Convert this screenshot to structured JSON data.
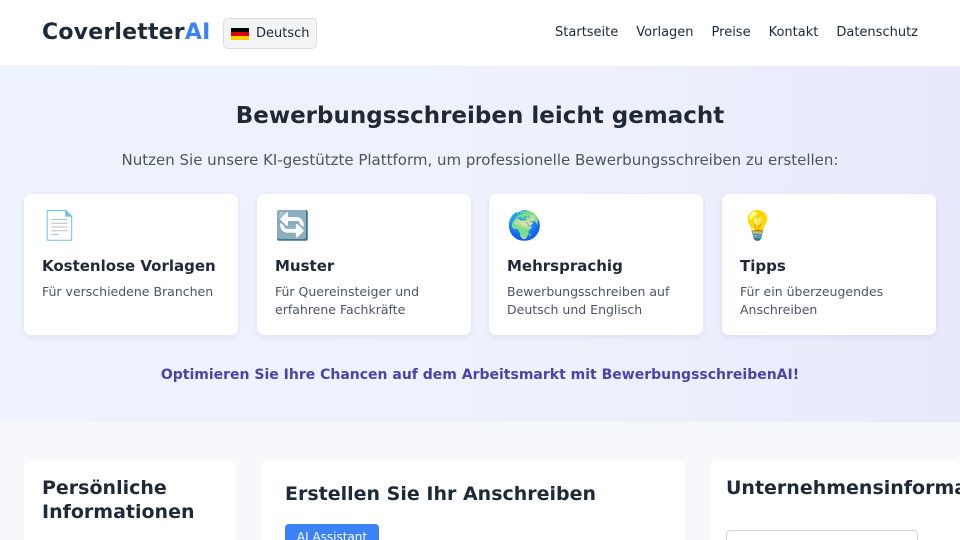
{
  "header": {
    "logo_main": "Coverletter",
    "logo_ai": "AI",
    "language": "Deutsch",
    "nav": [
      "Startseite",
      "Vorlagen",
      "Preise",
      "Kontakt",
      "Datenschutz"
    ]
  },
  "hero": {
    "title": "Bewerbungsschreiben leicht gemacht",
    "subtitle": "Nutzen Sie unsere KI-gestützte Plattform, um professionelle Bewerbungsschreiben zu erstellen:",
    "cards": [
      {
        "icon": "📄",
        "title": "Kostenlose Vorlagen",
        "desc": "Für verschiedene Branchen"
      },
      {
        "icon": "🔄",
        "title": "Muster",
        "desc": "Für Quereinsteiger und erfahrene Fachkräfte"
      },
      {
        "icon": "🌍",
        "title": "Mehrsprachig",
        "desc": "Bewerbungsschreiben auf Deutsch und Englisch"
      },
      {
        "icon": "💡",
        "title": "Tipps",
        "desc": "Für ein überzeugendes Anschreiben"
      }
    ],
    "cta": "Optimieren Sie Ihre Chancen auf dem Arbeitsmarkt mit BewerbungsschreibenAI!"
  },
  "sections": {
    "personal_title": "Persönliche Informationen",
    "create_title": "Erstellen Sie Ihr Anschreiben",
    "ai_button": "AI Assistant",
    "company_title": "Unternehmensinformationen"
  },
  "colors": {
    "accent": "#3b82f6",
    "cta": "#4a44a8"
  }
}
